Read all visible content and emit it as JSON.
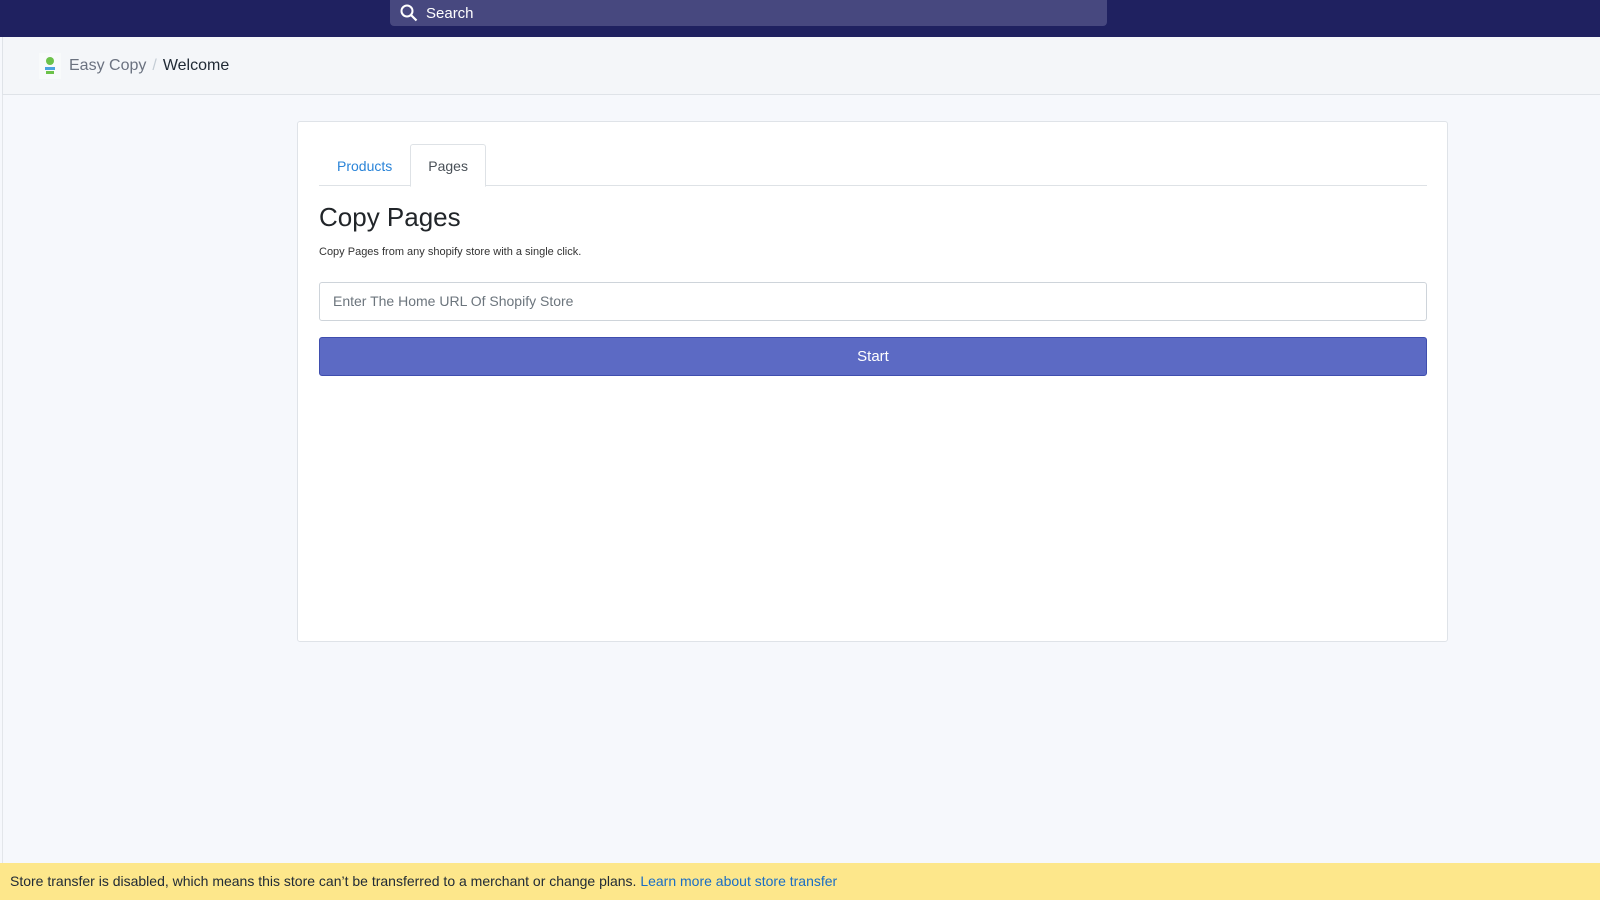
{
  "topbar": {
    "search_placeholder": "Search"
  },
  "breadcrumb": {
    "app": "Easy Copy",
    "current": "Welcome",
    "separator": "/"
  },
  "tabs": [
    {
      "label": "Products",
      "active": false
    },
    {
      "label": "Pages",
      "active": true
    }
  ],
  "main": {
    "title": "Copy Pages",
    "description": "Copy Pages from any shopify store with a single click.",
    "url_placeholder": "Enter The Home URL Of Shopify Store",
    "start_label": "Start"
  },
  "banner": {
    "text": "Store transfer is disabled, which means this store can’t be transferred to a merchant or change plans.",
    "link": "Learn more about store transfer"
  }
}
